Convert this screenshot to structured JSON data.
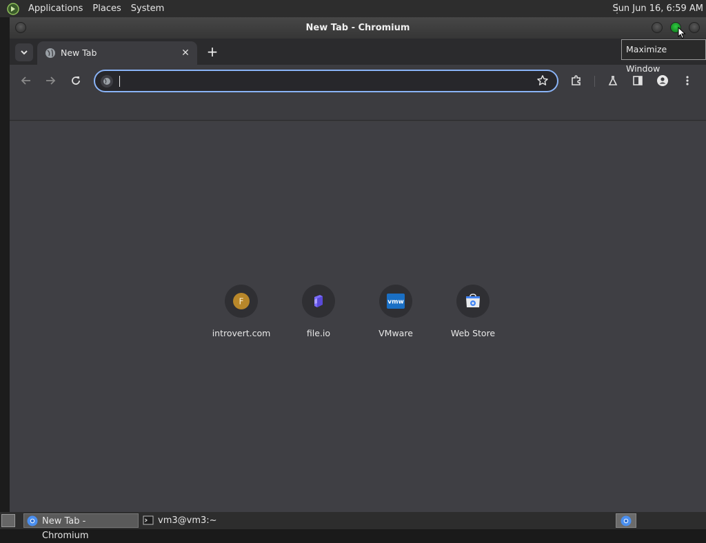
{
  "top_panel": {
    "menus": [
      "Applications",
      "Places",
      "System"
    ],
    "clock": "Sun Jun 16,  6:59 AM"
  },
  "window": {
    "title": "New Tab - Chromium"
  },
  "tabs": {
    "active_title": "New Tab",
    "close_glyph": "✕",
    "new_tab_glyph": "+"
  },
  "omnibox": {
    "value": "",
    "placeholder": ""
  },
  "shortcuts": [
    {
      "label": "introvert.com",
      "icon": "letter-f-icon",
      "letter": "F",
      "color": "#b8872a"
    },
    {
      "label": "file.io",
      "icon": "file-io-icon",
      "color": "#6b5cff"
    },
    {
      "label": "VMware",
      "icon": "vmware-icon",
      "text": "vmw",
      "color": "#1a6fc4"
    },
    {
      "label": "Web Store",
      "icon": "web-store-icon",
      "color": "#4285f4"
    }
  ],
  "tooltip": {
    "text": "Maximize Window"
  },
  "taskbar": {
    "tasks": [
      "New Tab - Chromium",
      "vm3@vm3:~"
    ]
  },
  "colors": {
    "accent_focus": "#8ab4f8",
    "maximize_green": "#2ecc40"
  }
}
